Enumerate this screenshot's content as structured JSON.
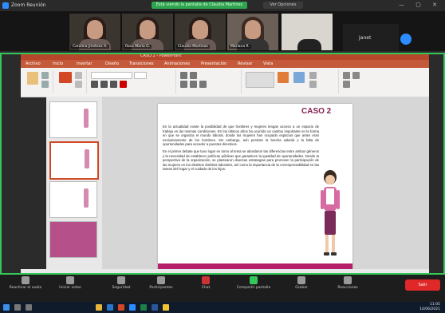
{
  "zoom": {
    "title": "Zoom Reunión",
    "share_banner": "Está viendo la pantalla de Claudia Martínez",
    "view_options": "Ver Opciones",
    "participants": [
      {
        "name": "Carolina Jiménez A."
      },
      {
        "name": "Rosa María G."
      },
      {
        "name": "Claudia Martínez"
      },
      {
        "name": "Mariana R."
      }
    ],
    "janet_label": "Janet",
    "controls": [
      {
        "label": "Reactivar el audio"
      },
      {
        "label": "Iniciar video"
      },
      {
        "label": "Seguridad"
      },
      {
        "label": "Participantes"
      },
      {
        "label": "Chat"
      },
      {
        "label": "Compartir pantalla"
      },
      {
        "label": "Grabar"
      },
      {
        "label": "Reacciones"
      }
    ],
    "end_button": "Salir"
  },
  "powerpoint": {
    "title": "CASO 2 - PowerPoint",
    "tabs": [
      "Archivo",
      "Inicio",
      "Insertar",
      "Diseño",
      "Transiciones",
      "Animaciones",
      "Presentación",
      "Revisar",
      "Vista"
    ]
  },
  "slide": {
    "title": "CASO 2",
    "paragraphs": [
      "En la actualidad existe la posibilidad de que hombres y mujeres tengan acceso a un espacio de trabajo en las mismas condiciones. En los últimos años ha ocurrido un cambio importante en la forma en que se organiza el mundo laboral, donde las mujeres han ocupado espacios que antes eran exclusivamente de los hombres. Sin embargo, aún persiste la brecha salarial y la falta de oportunidades para acceder a puestos directivos.",
      "En el primer debate que tuvo lugar en torno al tema se abordaron las diferencias entre ambos géneros y la necesidad de establecer políticas públicas que garanticen la igualdad de oportunidades. Desde la perspectiva de la organización, se plantearon diversas estrategias para promover la participación de las mujeres en los distintos ámbitos laborales, así como la importancia de la corresponsabilidad en las tareas del hogar y el cuidado de los hijos."
    ]
  },
  "taskbar": {
    "time": "11:05",
    "date": "14/06/2021"
  }
}
